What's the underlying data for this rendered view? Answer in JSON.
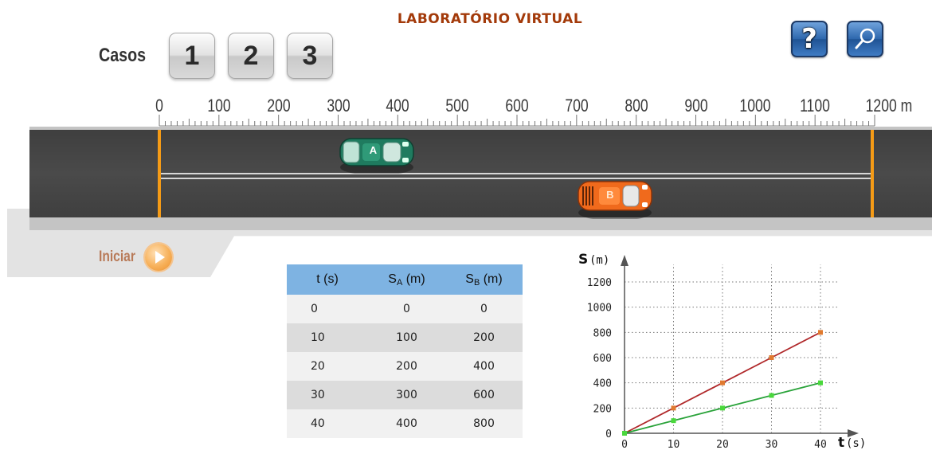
{
  "title": "LABORATÓRIO VIRTUAL",
  "cases": {
    "label": "Casos",
    "buttons": [
      "1",
      "2",
      "3"
    ]
  },
  "toolbar": {
    "help_label": "?",
    "help_icon": "question-mark-icon",
    "zoom_icon": "magnifier-icon"
  },
  "ruler": {
    "labels": [
      "0",
      "100",
      "200",
      "300",
      "400",
      "500",
      "600",
      "700",
      "800",
      "900",
      "1000",
      "1100",
      "1200 m"
    ],
    "min": 0,
    "max": 1200
  },
  "cars": [
    {
      "label": "A",
      "position": 300,
      "color": "#1f7b5f"
    },
    {
      "label": "B",
      "position": 700,
      "color": "#f06a1c"
    }
  ],
  "start": {
    "label": "Iniciar",
    "icon": "play-icon"
  },
  "table": {
    "headers": [
      {
        "main": "t",
        "sub": "",
        "unit": " (s)"
      },
      {
        "main": "S",
        "sub": "A",
        "unit": " (m)"
      },
      {
        "main": "S",
        "sub": "B",
        "unit": " (m)"
      }
    ],
    "rows": [
      [
        "0",
        "0",
        "0"
      ],
      [
        "10",
        "100",
        "200"
      ],
      [
        "20",
        "200",
        "400"
      ],
      [
        "30",
        "300",
        "600"
      ],
      [
        "40",
        "400",
        "800"
      ]
    ]
  },
  "chart_data": {
    "type": "line",
    "x": [
      0,
      10,
      20,
      30,
      40
    ],
    "series": [
      {
        "values": [
          0,
          200,
          400,
          600,
          800
        ],
        "color": "#b0282a",
        "marker_color": "#e07a30"
      },
      {
        "values": [
          0,
          100,
          200,
          300,
          400
        ],
        "color": "#2aa33a",
        "marker_color": "#4ad83c"
      }
    ],
    "ylabel_main": "S",
    "ylabel_unit": "(m)",
    "xlabel_main": "t",
    "xlabel_unit": "(s)",
    "xticks": [
      "0",
      "10",
      "20",
      "30",
      "40"
    ],
    "yticks": [
      "0",
      "200",
      "400",
      "600",
      "800",
      "1000",
      "1200"
    ],
    "xlim": [
      0,
      40
    ],
    "ylim": [
      0,
      1200
    ],
    "grid": true
  }
}
